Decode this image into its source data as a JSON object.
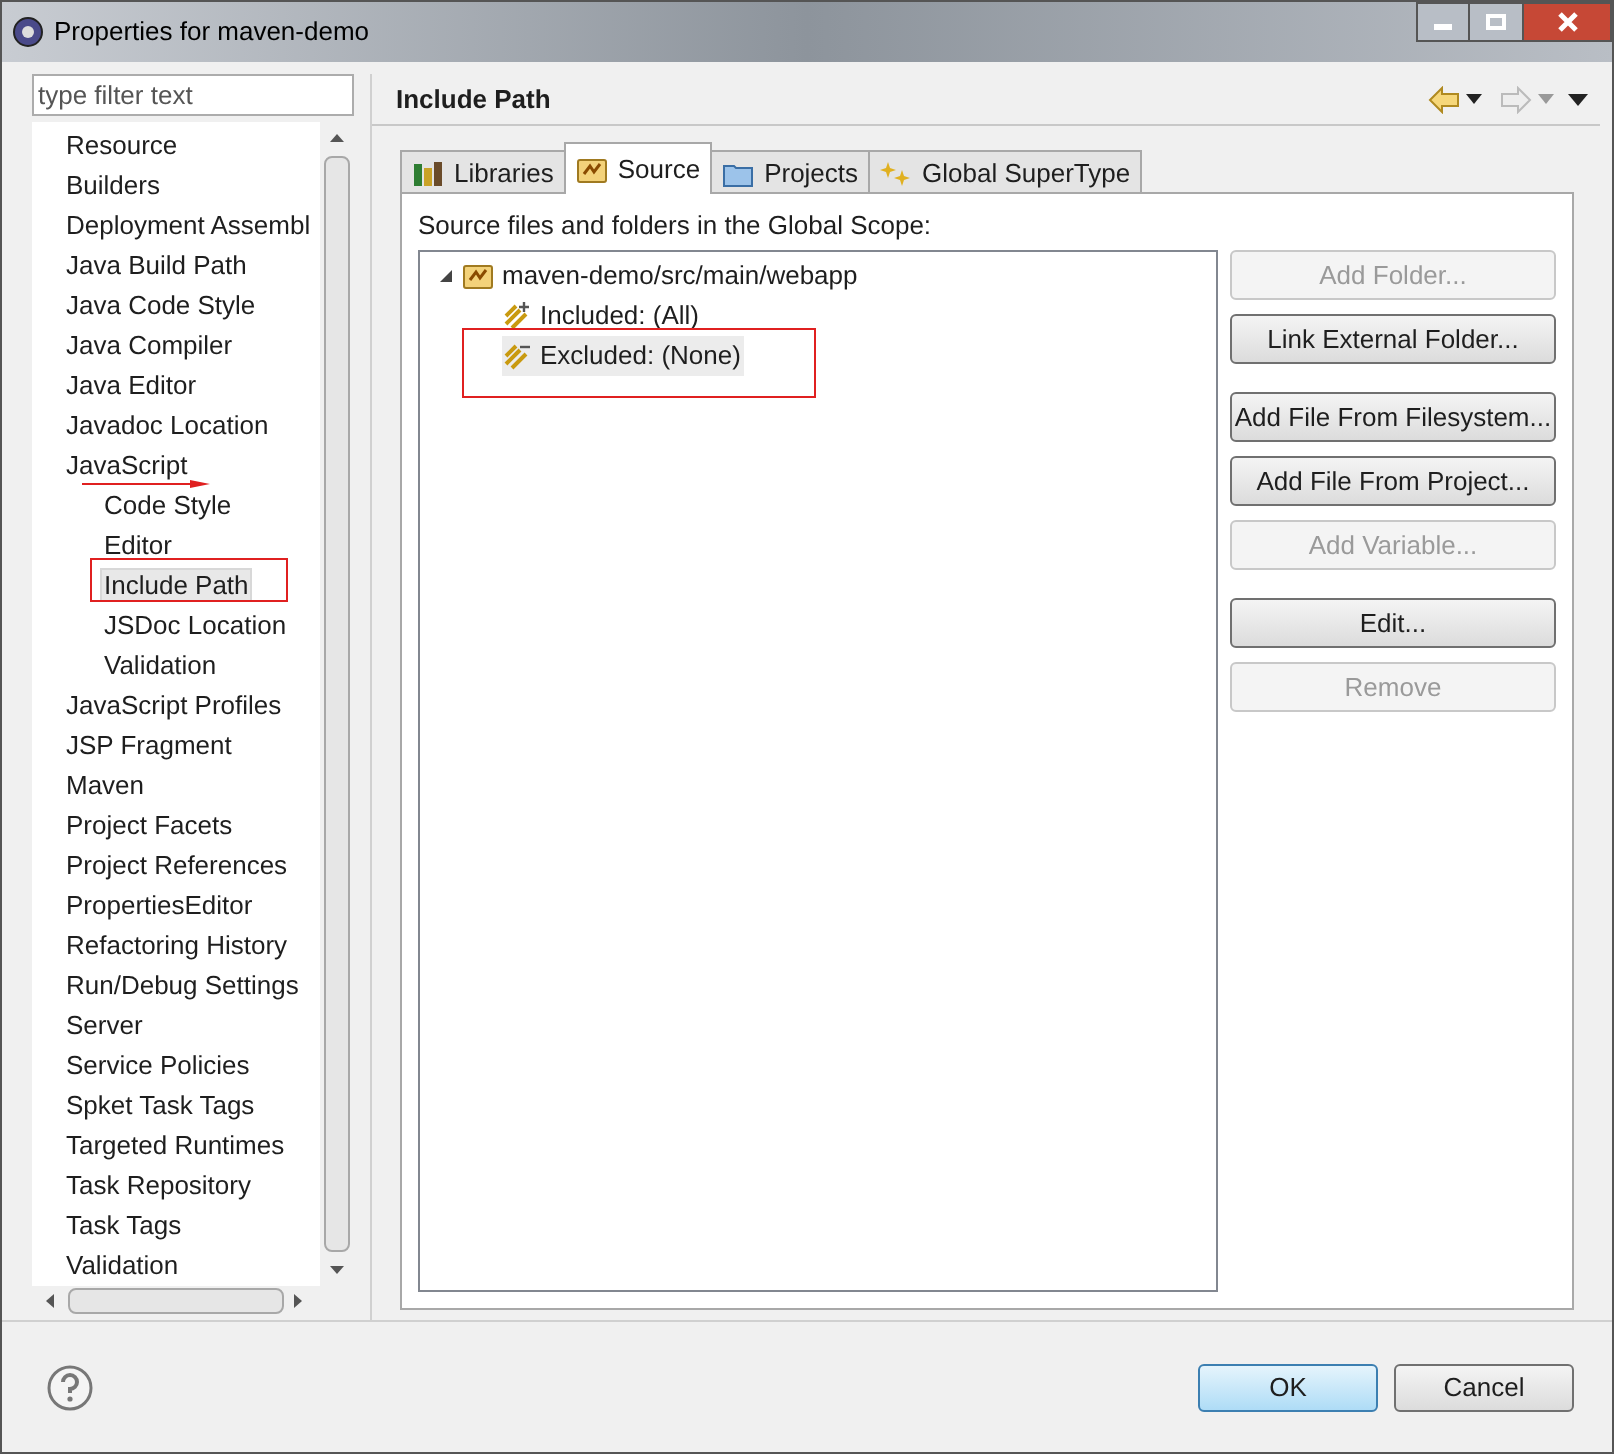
{
  "window": {
    "title": "Properties for maven-demo"
  },
  "filter": {
    "placeholder": "type filter text"
  },
  "sidebar": {
    "items": [
      {
        "label": "Resource",
        "selected": false
      },
      {
        "label": "Builders",
        "selected": false
      },
      {
        "label": "Deployment Assembl",
        "selected": false
      },
      {
        "label": "Java Build Path",
        "selected": false
      },
      {
        "label": "Java Code Style",
        "selected": false
      },
      {
        "label": "Java Compiler",
        "selected": false
      },
      {
        "label": "Java Editor",
        "selected": false
      },
      {
        "label": "Javadoc Location",
        "selected": false
      },
      {
        "label": "JavaScript",
        "selected": false,
        "children": [
          {
            "label": "Code Style",
            "selected": false
          },
          {
            "label": "Editor",
            "selected": false
          },
          {
            "label": "Include Path",
            "selected": true
          },
          {
            "label": "JSDoc Location",
            "selected": false
          },
          {
            "label": "Validation",
            "selected": false
          }
        ]
      },
      {
        "label": "JavaScript Profiles",
        "selected": false
      },
      {
        "label": "JSP Fragment",
        "selected": false
      },
      {
        "label": "Maven",
        "selected": false
      },
      {
        "label": "Project Facets",
        "selected": false
      },
      {
        "label": "Project References",
        "selected": false
      },
      {
        "label": "PropertiesEditor",
        "selected": false
      },
      {
        "label": "Refactoring History",
        "selected": false
      },
      {
        "label": "Run/Debug Settings",
        "selected": false
      },
      {
        "label": "Server",
        "selected": false
      },
      {
        "label": "Service Policies",
        "selected": false
      },
      {
        "label": "Spket Task Tags",
        "selected": false
      },
      {
        "label": "Targeted Runtimes",
        "selected": false
      },
      {
        "label": "Task Repository",
        "selected": false
      },
      {
        "label": "Task Tags",
        "selected": false
      },
      {
        "label": "Validation",
        "selected": false
      }
    ]
  },
  "page": {
    "title": "Include Path",
    "tabs": [
      {
        "label": "Libraries",
        "kind": "libraries",
        "selected": false
      },
      {
        "label": "Source",
        "kind": "source",
        "selected": true
      },
      {
        "label": "Projects",
        "kind": "projects",
        "selected": false
      },
      {
        "label": "Global SuperType",
        "kind": "supertype",
        "selected": false
      }
    ],
    "caption": "Source files and folders in the Global Scope:",
    "tree": {
      "label": "maven-demo/src/main/webapp",
      "expanded": true,
      "children": [
        {
          "label": "Included: (All)",
          "selected": false
        },
        {
          "label": "Excluded: (None)",
          "selected": true
        }
      ]
    },
    "button_groups": [
      [
        {
          "label": "Add Folder...",
          "disabled": true
        },
        {
          "label": "Link External Folder...",
          "disabled": false
        }
      ],
      [
        {
          "label": "Add File From Filesystem...",
          "disabled": false
        },
        {
          "label": "Add File From Project...",
          "disabled": false
        },
        {
          "label": "Add Variable...",
          "disabled": true
        }
      ],
      [
        {
          "label": "Edit...",
          "disabled": false
        },
        {
          "label": "Remove",
          "disabled": true
        }
      ]
    ]
  },
  "footer": {
    "ok": "OK",
    "cancel": "Cancel"
  }
}
